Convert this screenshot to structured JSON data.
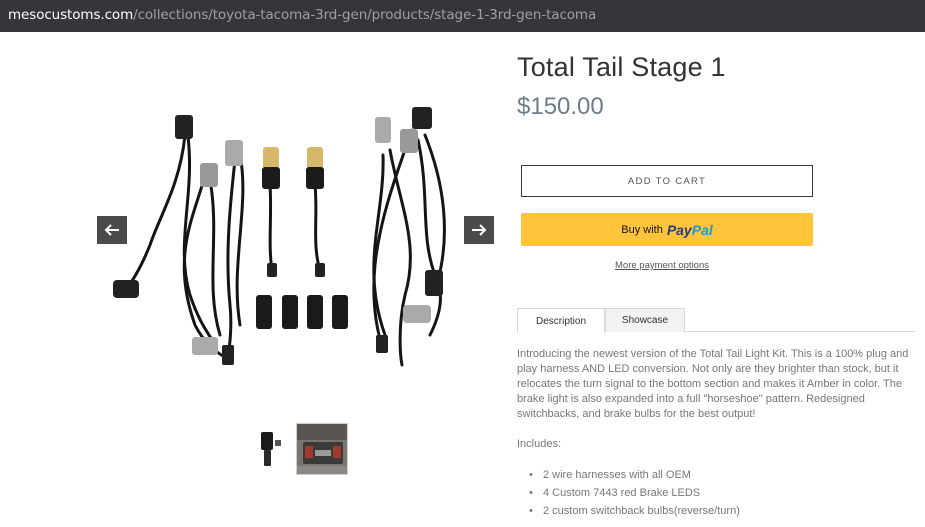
{
  "browser": {
    "url_domain": "mesocustoms.com",
    "url_path": "/collections/toyota-tacoma-3rd-gen/products/stage-1-3rd-gen-tacoma"
  },
  "product": {
    "title": "Total Tail Stage 1",
    "price": "$150.00",
    "add_to_cart_label": "ADD TO CART",
    "paypal_prefix": "Buy with",
    "paypal_brand_1": "Pay",
    "paypal_brand_2": "Pal",
    "more_payment_label": "More payment options"
  },
  "gallery": {
    "prev_icon": "arrow-left-icon",
    "next_icon": "arrow-right-icon"
  },
  "tabs": [
    {
      "label": "Description"
    },
    {
      "label": "Showcase"
    }
  ],
  "description": {
    "text": "Introducing the newest version of the Total Tail Light Kit.  This is a 100% plug and play harness AND LED conversion. Not only are they brighter than stock, but it relocates the turn signal to the bottom section and makes it Amber in color. The brake light is also expanded into a full \"horseshoe\" pattern. Redesigned switchbacks, and brake bulbs for the best output!",
    "includes_label": "Includes:",
    "includes": [
      "2 wire harnesses with all OEM",
      "4 Custom 7443 red Brake LEDS",
      "2 custom switchback bulbs(reverse/turn)"
    ]
  },
  "colors": {
    "paypal_yellow": "#ffc439",
    "price_color": "#6d7c87",
    "arrow_bg": "#4b4b4b"
  }
}
